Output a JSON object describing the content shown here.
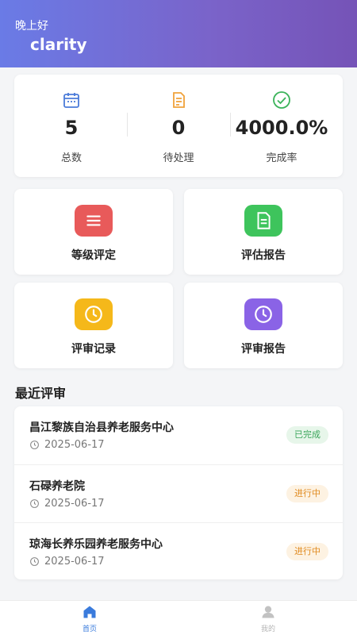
{
  "header": {
    "greeting": "晚上好",
    "username": "clarity"
  },
  "stats": [
    {
      "icon": "calendar-icon",
      "value": "5",
      "label": "总数",
      "color": "#4b7bd9"
    },
    {
      "icon": "document-icon",
      "value": "0",
      "label": "待处理",
      "color": "#f0a23b"
    },
    {
      "icon": "check-circle-icon",
      "value": "4000.0%",
      "label": "完成率",
      "color": "#3bb35a"
    }
  ],
  "menu": [
    {
      "label": "等级评定",
      "icon": "list-icon",
      "color": "#e85a5a"
    },
    {
      "label": "评估报告",
      "icon": "report-icon",
      "color": "#3ec45c"
    },
    {
      "label": "评审记录",
      "icon": "clock-icon",
      "color": "#f5b81a"
    },
    {
      "label": "评审报告",
      "icon": "clock-icon",
      "color": "#8a63e6"
    }
  ],
  "recent": {
    "title": "最近评审",
    "items": [
      {
        "name": "昌江黎族自治县养老服务中心",
        "date": "2025-06-17",
        "status": "已完成"
      },
      {
        "name": "石碌养老院",
        "date": "2025-06-17",
        "status": "进行中"
      },
      {
        "name": "琼海长养乐园养老服务中心",
        "date": "2025-06-17",
        "status": "进行中"
      }
    ]
  },
  "tabs": [
    {
      "label": "首页",
      "icon": "home-icon",
      "active": true,
      "color": "#3a7bdc"
    },
    {
      "label": "我的",
      "icon": "user-icon",
      "active": false,
      "color": "#b5b5b5"
    }
  ]
}
